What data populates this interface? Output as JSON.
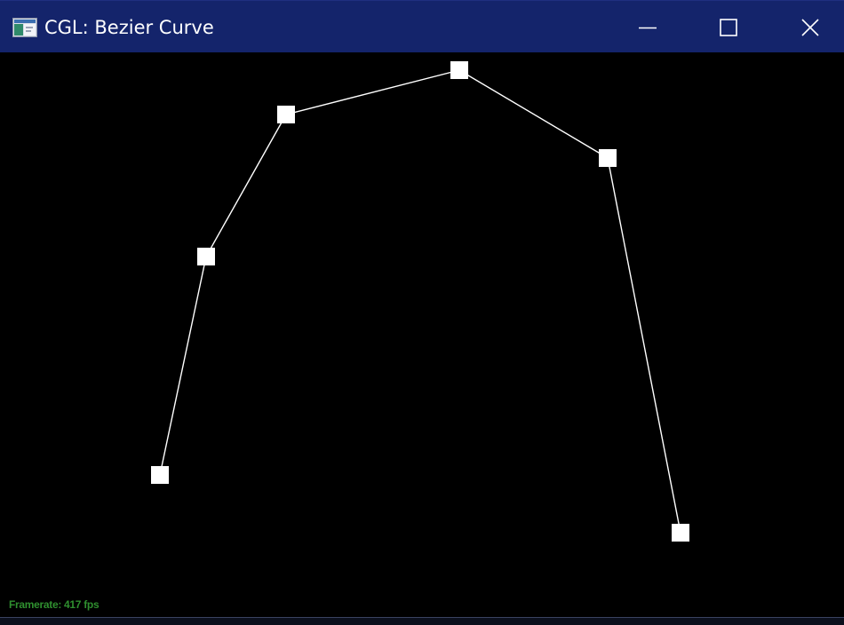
{
  "window": {
    "title": "CGL: Bezier Curve",
    "colors": {
      "titlebar": "#14246b",
      "background": "#000000",
      "curve": "#ffffff",
      "framerate_text": "#2f8f2f"
    }
  },
  "controls": {
    "minimize_icon": "minimize-icon",
    "maximize_icon": "maximize-icon",
    "close_icon": "close-icon"
  },
  "status": {
    "framerate_label": "Framerate: 417 fps"
  }
}
